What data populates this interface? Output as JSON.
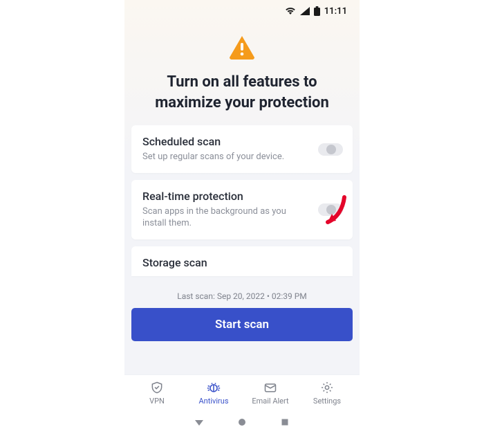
{
  "statusbar": {
    "time": "11:11"
  },
  "hero": {
    "title_line1": "Turn on all features to",
    "title_line2": "maximize your protection"
  },
  "features": {
    "scheduled": {
      "title": "Scheduled scan",
      "desc": "Set up regular scans of your device.",
      "enabled": false
    },
    "realtime": {
      "title": "Real-time protection",
      "desc": "Scan apps in the background as you install them.",
      "enabled": false
    },
    "storage": {
      "title": "Storage scan"
    }
  },
  "lastscan": "Last scan: Sep 20, 2022 • 02:39 PM",
  "cta": "Start scan",
  "nav": {
    "vpn": "VPN",
    "antivirus": "Antivirus",
    "email": "Email Alert",
    "settings": "Settings",
    "active": "antivirus"
  },
  "colors": {
    "accent": "#3850c9",
    "warning": "#f59b1c"
  }
}
